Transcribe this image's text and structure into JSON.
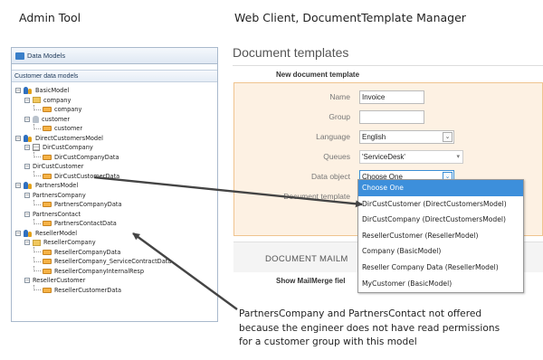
{
  "headings": {
    "admin": "Admin Tool",
    "web": "Web Client, DocumentTemplate Manager"
  },
  "admin": {
    "window_title": "Data Models",
    "panel_header": "Customer data models",
    "tree": [
      {
        "label": "BasicModel",
        "icon": "model-icon",
        "level": 0,
        "toggle": "−"
      },
      {
        "label": "company",
        "icon": "folder-icon",
        "level": 1,
        "toggle": "−"
      },
      {
        "label": "company",
        "icon": "data-icon",
        "level": 2
      },
      {
        "label": "customer",
        "icon": "user-icon",
        "level": 1,
        "toggle": "−"
      },
      {
        "label": "customer",
        "icon": "data-icon",
        "level": 2
      },
      {
        "label": "DirectCustomersModel",
        "icon": "model-icon",
        "level": 0,
        "toggle": "−"
      },
      {
        "label": "DirCustCompany",
        "icon": "table-icon",
        "level": 1,
        "toggle": "−"
      },
      {
        "label": "DirCustCompanyData",
        "icon": "data-icon",
        "level": 2
      },
      {
        "label": "DirCustCustomer",
        "icon": "",
        "level": 1,
        "toggle": "−"
      },
      {
        "label": "DirCustCustomerData",
        "icon": "data-icon",
        "level": 2
      },
      {
        "label": "PartnersModel",
        "icon": "model-icon",
        "level": 0,
        "toggle": "−"
      },
      {
        "label": "PartnersCompany",
        "icon": "",
        "level": 1,
        "toggle": "−"
      },
      {
        "label": "PartnersCompanyData",
        "icon": "data-icon",
        "level": 2
      },
      {
        "label": "PartnersContact",
        "icon": "",
        "level": 1,
        "toggle": "−"
      },
      {
        "label": "PartnersContactData",
        "icon": "data-icon",
        "level": 2
      },
      {
        "label": "ResellerModel",
        "icon": "model-icon",
        "level": 0,
        "toggle": "−"
      },
      {
        "label": "ResellerCompany",
        "icon": "folder-icon",
        "level": 1,
        "toggle": "−"
      },
      {
        "label": "ResellerCompanyData",
        "icon": "data-icon",
        "level": 2
      },
      {
        "label": "ResellerCompany_ServiceContractData",
        "icon": "data-icon",
        "level": 2
      },
      {
        "label": "ResellerCompanyInternalResp",
        "icon": "data-icon",
        "level": 2
      },
      {
        "label": "ResellerCustomer",
        "icon": "",
        "level": 1,
        "toggle": "−"
      },
      {
        "label": "ResellerCustomerData",
        "icon": "data-icon",
        "level": 2
      }
    ]
  },
  "web": {
    "page_title": "Document templates",
    "new_template_label": "New document template",
    "form": {
      "name_label": "Name",
      "name_value": "Invoice",
      "group_label": "Group",
      "group_value": "",
      "language_label": "Language",
      "language_value": "English",
      "queues_label": "Queues",
      "queues_value": "'ServiceDesk'",
      "data_object_label": "Data object",
      "data_object_value": "Choose One",
      "document_template_label": "Document template"
    },
    "data_object_options": [
      "Choose One",
      "DirCustCustomer (DirectCustomersModel)",
      "DirCustCompany (DirectCustomersModel)",
      "ResellerCustomer (ResellerModel)",
      "Company (BasicModel)",
      "Reseller Company Data (ResellerModel)",
      "MyCustomer (BasicModel)"
    ],
    "mailmerge_title": "DOCUMENT MAILM",
    "show_mailmerge_label": "Show MailMerge fiel"
  },
  "note_lines": [
    "PartnersCompany and PartnersContact not offered",
    "because the engineer does not have read permissions",
    "for a customer group with this model"
  ],
  "colors": {
    "accent": "#3d8fdb",
    "form_bg": "#fdf1e3",
    "form_border": "#f0c48f",
    "arrow": "#444444"
  }
}
